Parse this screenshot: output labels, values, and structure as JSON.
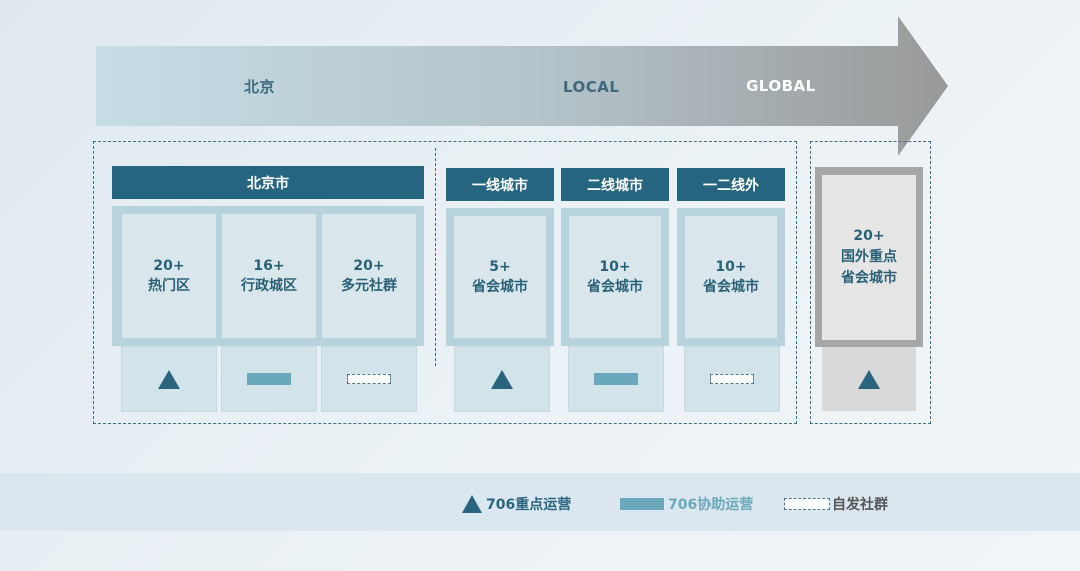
{
  "banner": {
    "labels": [
      "北京",
      "LOCAL",
      "GLOBAL"
    ]
  },
  "beijing": {
    "header": "北京市",
    "cells": [
      {
        "num": "20+",
        "text": "热门区",
        "marker": "triangle"
      },
      {
        "num": "16+",
        "text": "行政城区",
        "marker": "bar"
      },
      {
        "num": "20+",
        "text": "多元社群",
        "marker": "dashed"
      }
    ]
  },
  "local": [
    {
      "header": "一线城市",
      "num": "5+",
      "text": "省会城市",
      "marker": "triangle"
    },
    {
      "header": "二线城市",
      "num": "10+",
      "text": "省会城市",
      "marker": "bar"
    },
    {
      "header": "一二线外",
      "num": "10+",
      "text": "省会城市",
      "marker": "dashed"
    }
  ],
  "global": {
    "num": "20+",
    "line1": "国外重点",
    "line2": "省会城市",
    "marker": "triangle"
  },
  "legend": [
    {
      "icon": "triangle-icon",
      "label": "706重点运营",
      "color": "#2a6580"
    },
    {
      "icon": "bar-icon",
      "label": "706协助运营",
      "color": "#6aa8bb"
    },
    {
      "icon": "dashed-box-icon",
      "label": "自发社群",
      "color": "#555555"
    }
  ],
  "colors": {
    "header": "#25657f",
    "text": "#2b6177",
    "frame": "#b7d3dd",
    "global_frame": "#a6a6a6"
  }
}
